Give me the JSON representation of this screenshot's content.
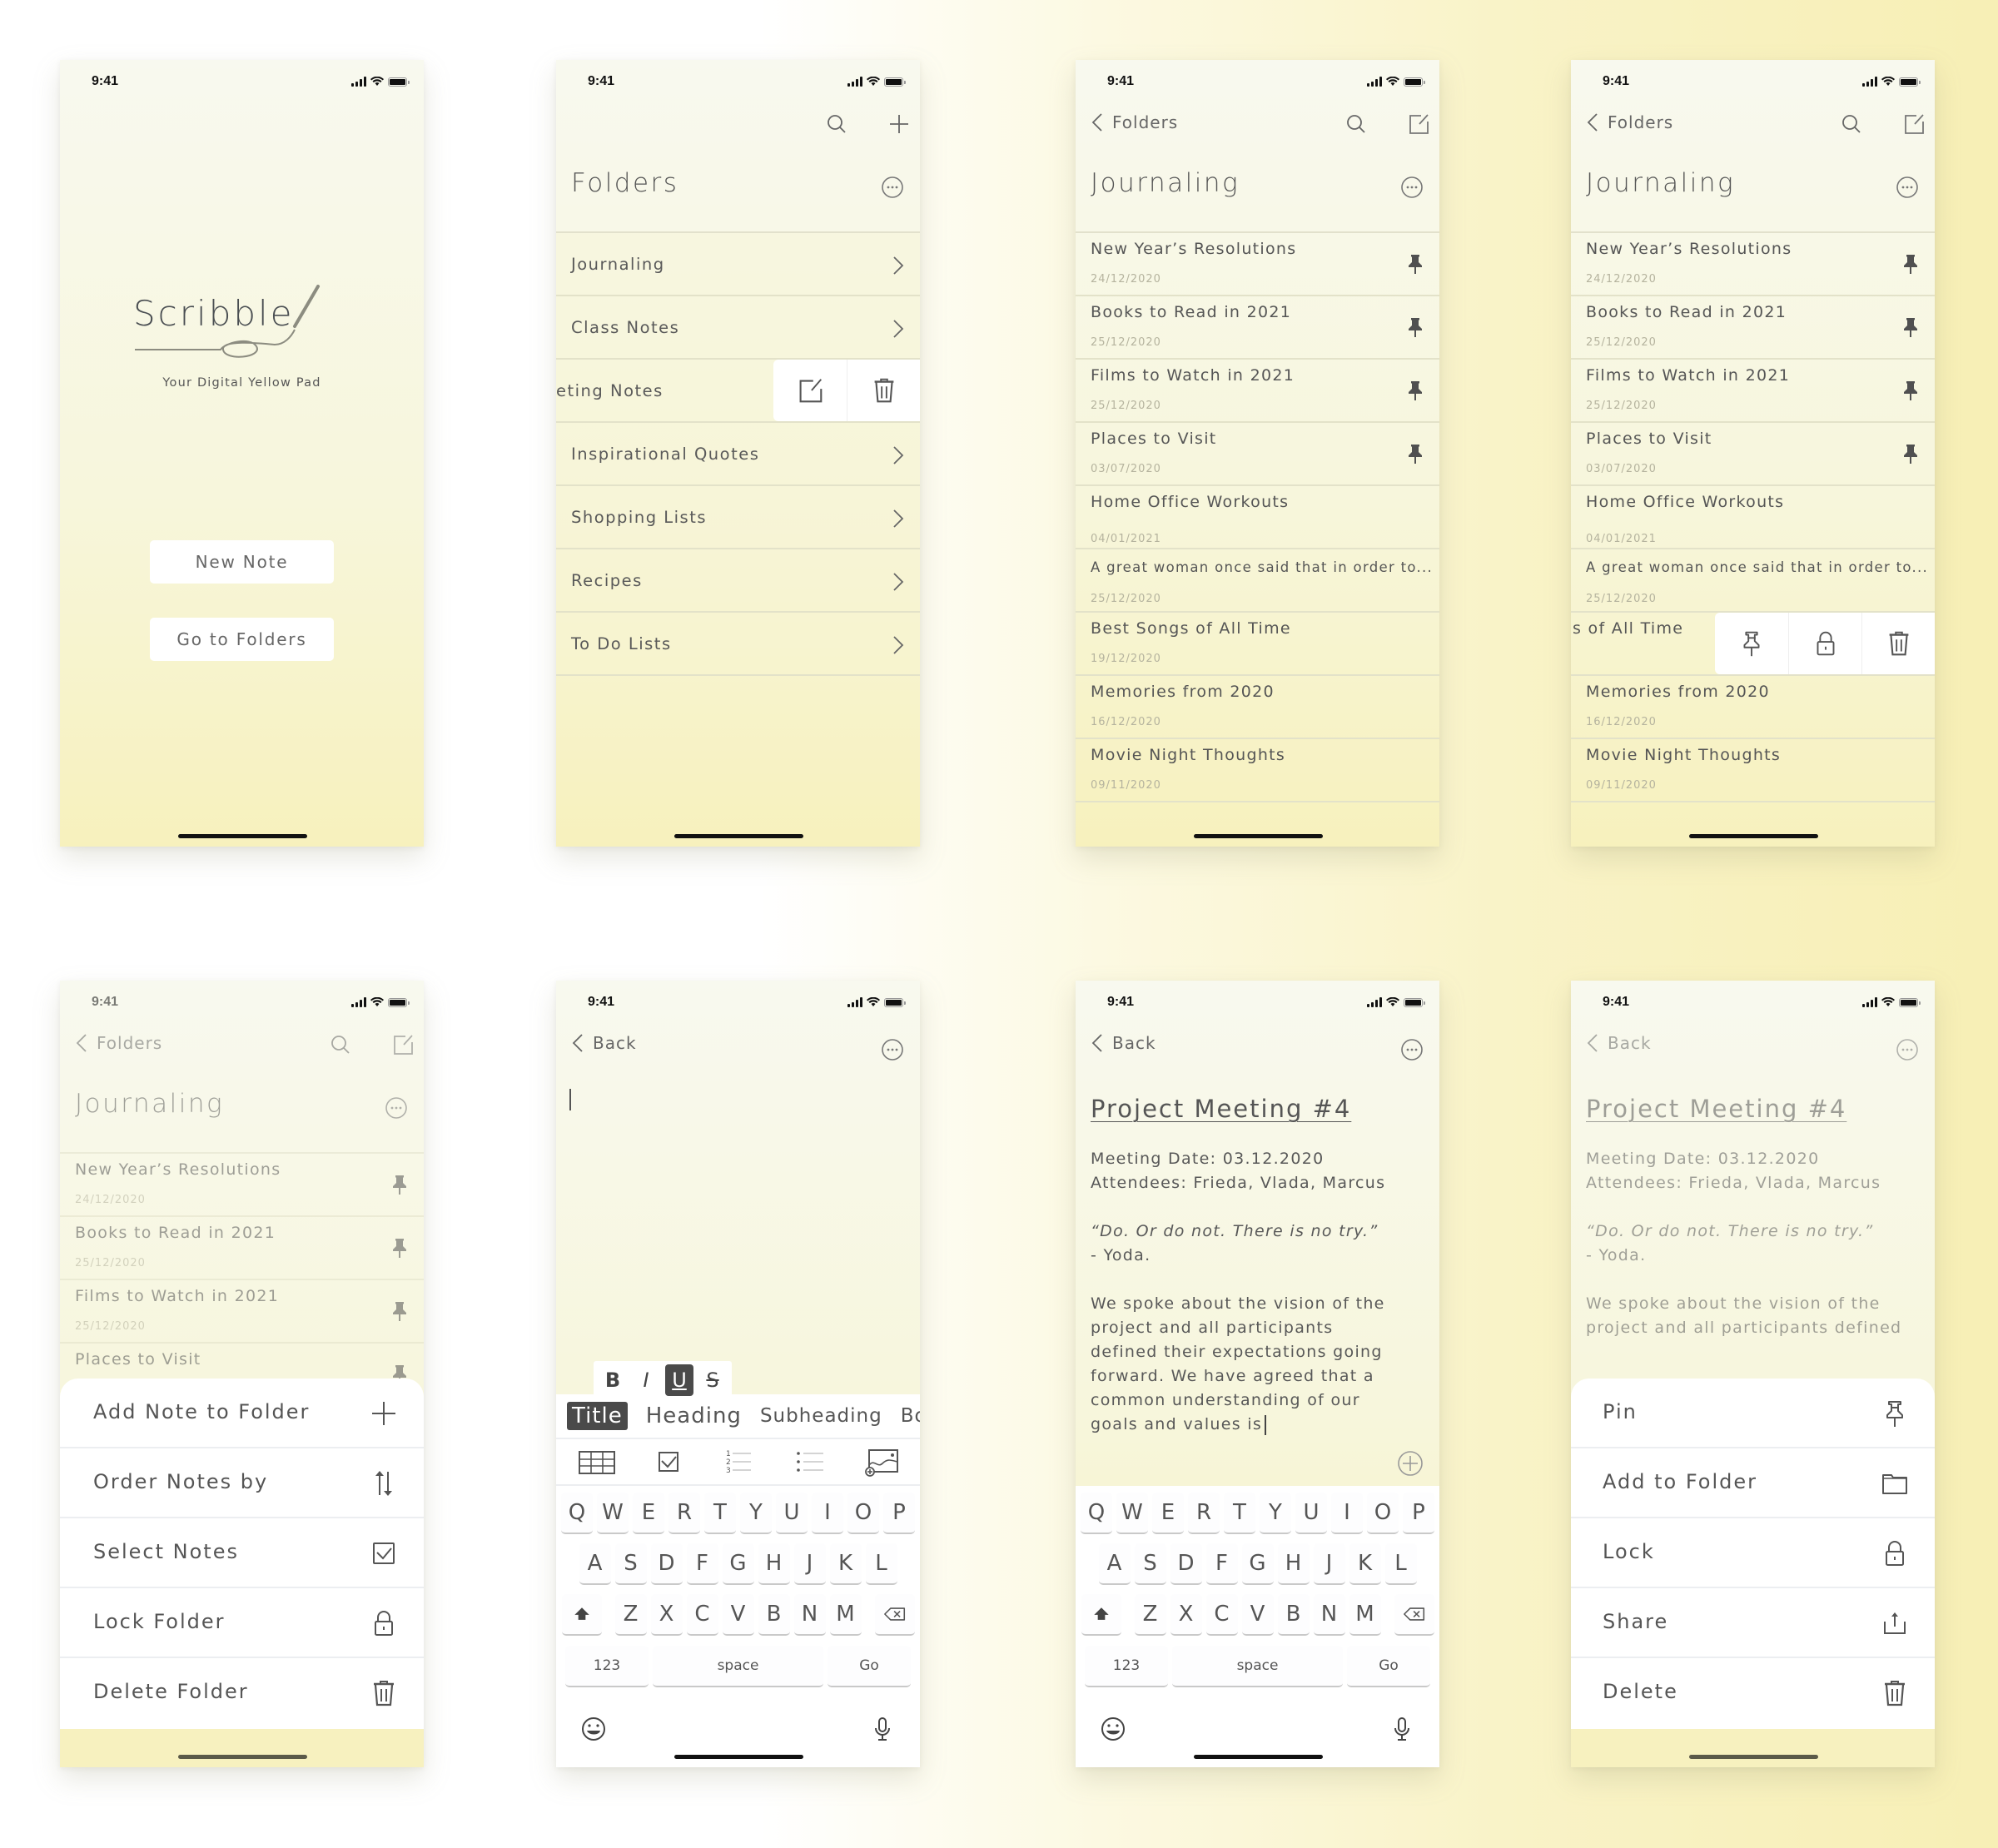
{
  "status": {
    "time": "9:41"
  },
  "screens": {
    "splash": {
      "logo": "Scribble",
      "tagline": "Your Digital Yellow Pad",
      "new_note": "New Note",
      "go_to_folders": "Go to Folders"
    },
    "folders": {
      "title": "Folders",
      "items": [
        "Journaling",
        "Class Notes",
        "Meeting Notes",
        "Inspirational Quotes",
        "Shopping Lists",
        "Recipes",
        "To Do Lists"
      ],
      "swiped_label": "eting Notes",
      "swipe_actions": [
        "edit",
        "delete"
      ]
    },
    "journaling": {
      "back_label": "Folders",
      "title": "Journaling",
      "notes": [
        {
          "title": "New Year’s Resolutions",
          "date": "24/12/2020",
          "pinned": true
        },
        {
          "title": "Books to Read in 2021",
          "date": "25/12/2020",
          "pinned": true
        },
        {
          "title": "Films to Watch in 2021",
          "date": "25/12/2020",
          "pinned": true
        },
        {
          "title": "Places to Visit",
          "date": "03/07/2020",
          "pinned": true
        },
        {
          "title": "Home Office Workouts",
          "date": "04/01/2021",
          "pinned": false
        },
        {
          "title": "A great woman once said that in order to...",
          "date": "25/12/2020",
          "pinned": false
        },
        {
          "title": "Best Songs of All Time",
          "date": "19/12/2020",
          "pinned": false
        },
        {
          "title": "Memories from 2020",
          "date": "16/12/2020",
          "pinned": false
        },
        {
          "title": "Movie Night Thoughts",
          "date": "09/11/2020",
          "pinned": false
        }
      ],
      "swiped_label": "s of All Time",
      "swipe_actions": [
        "pin",
        "lock",
        "delete"
      ]
    },
    "folder_menu": {
      "items": [
        {
          "label": "Add Note to Folder",
          "icon": "plus-icon"
        },
        {
          "label": "Order Notes by",
          "icon": "sort-icon"
        },
        {
          "label": "Select Notes",
          "icon": "checkbox-icon"
        },
        {
          "label": "Lock Folder",
          "icon": "lock-icon"
        },
        {
          "label": "Delete Folder",
          "icon": "trash-icon"
        }
      ]
    },
    "editor": {
      "back_label": "Back",
      "format": [
        "B",
        "I",
        "U",
        "S"
      ],
      "active_format": "U",
      "styles": [
        "Title",
        "Heading",
        "Subheading",
        "Bo"
      ],
      "active_style": "Title",
      "insert_tools": [
        "table",
        "checklist",
        "numbered-list",
        "bullet-list",
        "image"
      ]
    },
    "keyboard": {
      "row1": [
        "Q",
        "W",
        "E",
        "R",
        "T",
        "Y",
        "U",
        "I",
        "O",
        "P"
      ],
      "row2": [
        "A",
        "S",
        "D",
        "F",
        "G",
        "H",
        "J",
        "K",
        "L"
      ],
      "row3": [
        "Z",
        "X",
        "C",
        "V",
        "B",
        "N",
        "M"
      ],
      "numbers": "123",
      "space": "space",
      "go": "Go"
    },
    "note": {
      "back_label": "Back",
      "title": "Project Meeting #4",
      "meta_date": "Meeting Date: 03.12.2020",
      "meta_attendees": "Attendees: Frieda, Vlada, Marcus",
      "quote": "“Do. Or do not. There is no try.”",
      "quote_author": "- Yoda.",
      "body": "We spoke about the vision of the project and all participants defined their expectations going forward. We have agreed that a common understanding of our goals and values is",
      "body_preview": "We spoke about the vision of the project and all participants defined"
    },
    "note_menu": {
      "items": [
        {
          "label": "Pin",
          "icon": "pin-icon"
        },
        {
          "label": "Add to Folder",
          "icon": "folder-icon"
        },
        {
          "label": "Lock",
          "icon": "lock-icon"
        },
        {
          "label": "Share",
          "icon": "share-icon"
        },
        {
          "label": "Delete",
          "icon": "trash-icon"
        }
      ]
    }
  },
  "colors": {
    "paper_top": "#f8f9ef",
    "paper_bottom": "#f7f1bd",
    "text": "#555555",
    "date_text": "#b5b39e",
    "active": "#4a4a4a"
  }
}
